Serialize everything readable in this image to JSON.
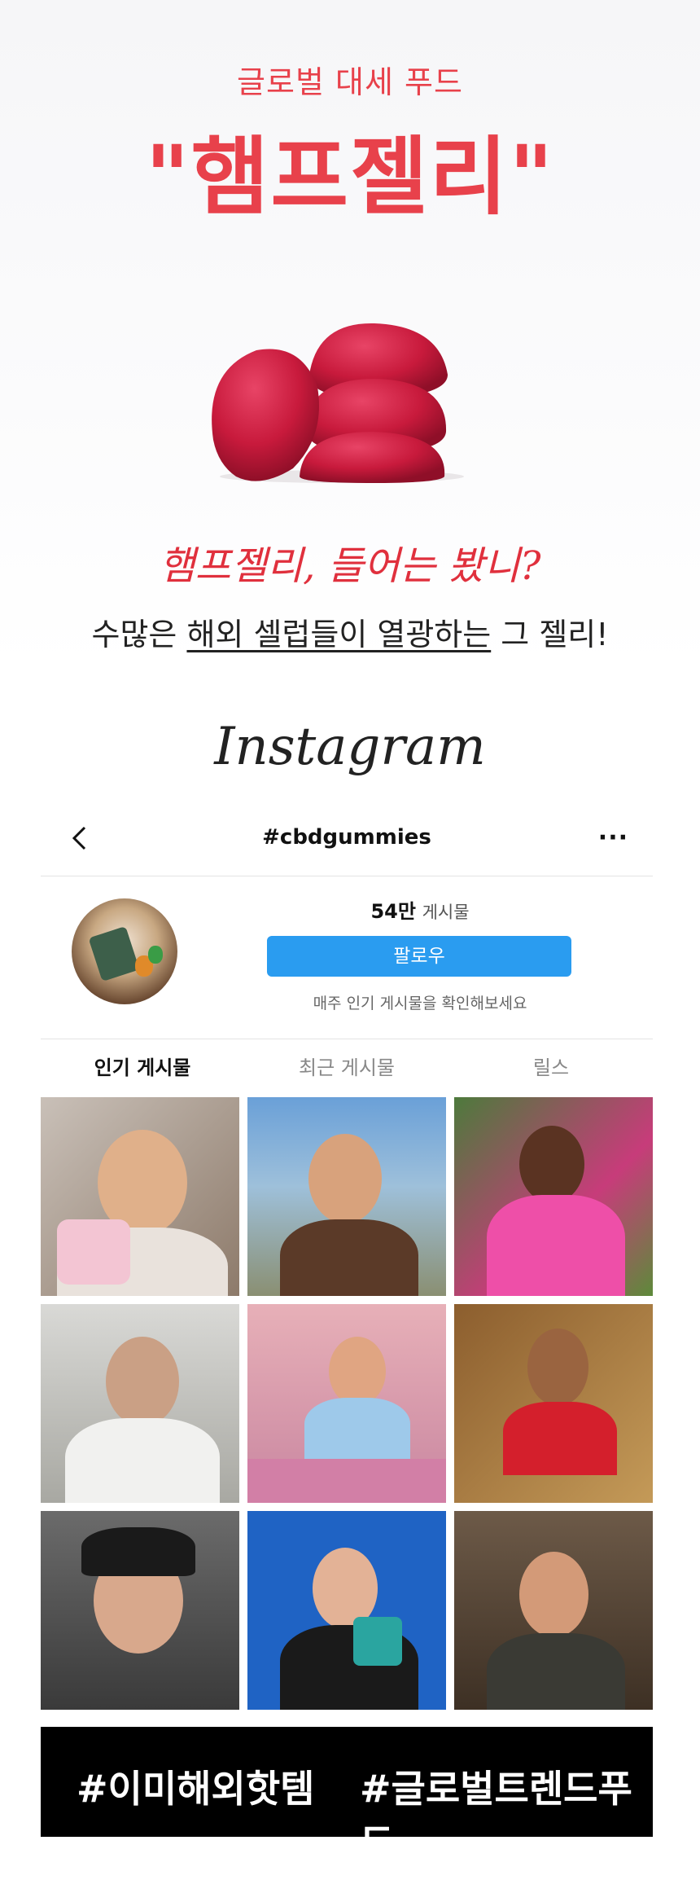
{
  "hero": {
    "subtitle": "글로벌 대세 푸드",
    "title": "\"햄프젤리\"",
    "script_line": "햄프젤리, 들어는 봤니?",
    "tagline_prefix": "수많은 ",
    "tagline_underlined": "해외 셀럽들이 열광하는",
    "tagline_suffix": " 그 젤리!",
    "accent_color": "#e8414b"
  },
  "instagram": {
    "logo_text": "Instagram",
    "header": {
      "hashtag": "#cbdgummies",
      "back_icon": "chevron-left-icon",
      "more_icon": "more-dots-icon",
      "more_glyph": "···"
    },
    "profile": {
      "post_count": "54만",
      "post_label": "게시물",
      "follow_label": "팔로우",
      "follow_color": "#2a9cf0",
      "note": "매주 인기 게시물을 확인해보세요"
    },
    "tabs": [
      {
        "label": "인기 게시물",
        "active": true
      },
      {
        "label": "최근 게시물",
        "active": false
      },
      {
        "label": "릴스",
        "active": false
      }
    ],
    "banner": {
      "left": "#이미해외핫템",
      "right": "#글로벌트렌드푸드"
    }
  }
}
